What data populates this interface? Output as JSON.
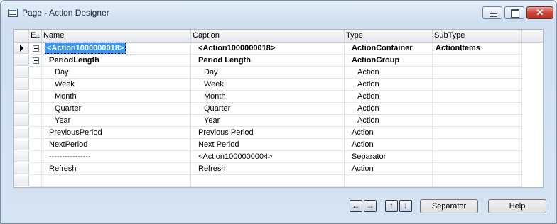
{
  "window": {
    "title": "Page - Action Designer",
    "close_glyph": "✕"
  },
  "grid": {
    "headers": [
      "E..",
      "Name",
      "Caption",
      "Type",
      "SubType"
    ],
    "rows": [
      {
        "name": "<Action1000000018>",
        "caption": "<Action1000000018>",
        "type": "ActionContainer",
        "subtype": "ActionItems"
      },
      {
        "name": "PeriodLength",
        "caption": "Period Length",
        "type": "ActionGroup",
        "subtype": ""
      },
      {
        "name": "Day",
        "caption": "Day",
        "type": "Action",
        "subtype": ""
      },
      {
        "name": "Week",
        "caption": "Week",
        "type": "Action",
        "subtype": ""
      },
      {
        "name": "Month",
        "caption": "Month",
        "type": "Action",
        "subtype": ""
      },
      {
        "name": "Quarter",
        "caption": "Quarter",
        "type": "Action",
        "subtype": ""
      },
      {
        "name": "Year",
        "caption": "Year",
        "type": "Action",
        "subtype": ""
      },
      {
        "name": "PreviousPeriod",
        "caption": "Previous Period",
        "type": "Action",
        "subtype": ""
      },
      {
        "name": "NextPeriod",
        "caption": "Next Period",
        "type": "Action",
        "subtype": ""
      },
      {
        "name": "----------------",
        "caption": "<Action1000000004>",
        "type": "Separator",
        "subtype": ""
      },
      {
        "name": "Refresh",
        "caption": "Refresh",
        "type": "Action",
        "subtype": ""
      }
    ]
  },
  "footer": {
    "nav": {
      "left": "←",
      "right": "→",
      "up": "↑",
      "down": "↓"
    },
    "separator_label": "Separator",
    "help_label": "Help"
  },
  "icons": [
    "app-window-icon",
    "minimize-icon",
    "maximize-icon",
    "close-icon",
    "row-selector-arrow-icon",
    "collapse-icon",
    "arrow-left-icon",
    "arrow-right-icon",
    "arrow-up-icon",
    "arrow-down-icon"
  ],
  "colors": {
    "selection": "#3399ff",
    "close_button": "#c9453a"
  }
}
